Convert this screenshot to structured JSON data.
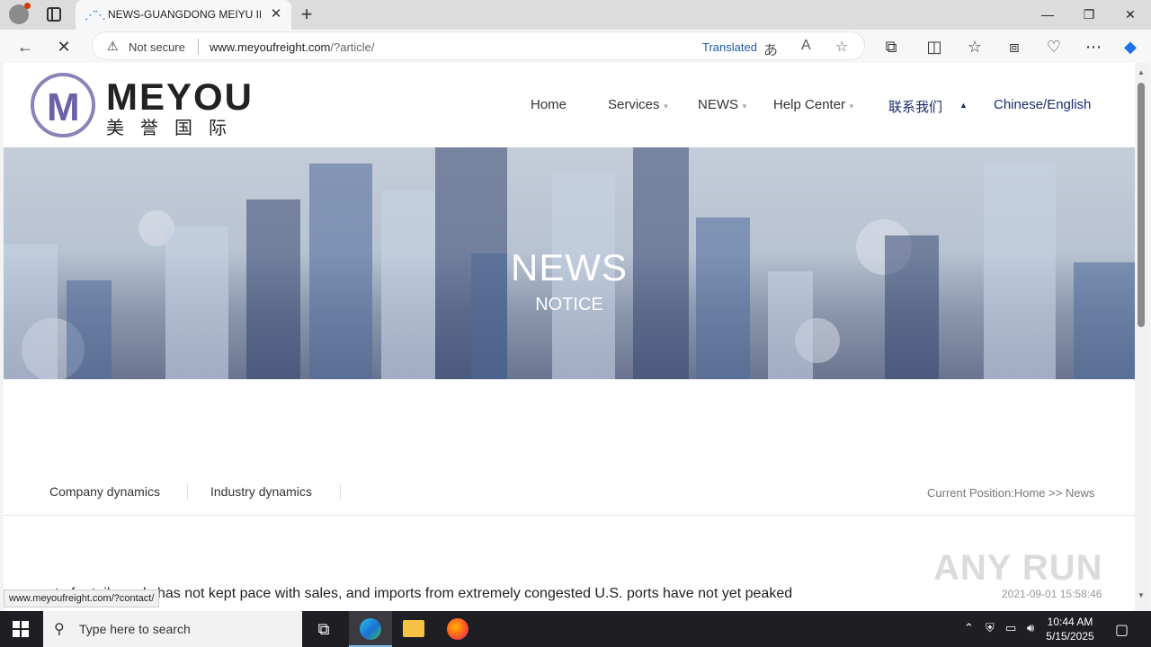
{
  "browser": {
    "tab_title": "NEWS-GUANGDONG MEIYU INTERNATIONAL",
    "tab_close": "✕",
    "new_tab": "+",
    "win_minimize": "—",
    "win_restore": "❐",
    "win_close": "✕",
    "not_secure": "Not secure",
    "url_host": "www.meyoufreight.com",
    "url_path": "/?article/",
    "translated": "Translated",
    "status_url": "www.meyoufreight.com/?contact/"
  },
  "site": {
    "logo_text": "MEYOU",
    "logo_cn": "美誉国际",
    "nav": {
      "home": "Home",
      "services": "Services",
      "news": "NEWS",
      "help": "Help Center",
      "contact_cn": "联系我们",
      "lang": "Chinese/English"
    },
    "banner_title": "NEWS",
    "banner_sub": "NOTICE",
    "subnav": {
      "company": "Company dynamics",
      "industry": "Industry dynamics",
      "crumb": "Current Position:Home >> News"
    },
    "article": {
      "title": "ment of retail goods has not kept pace with sales, and imports from extremely congested U.S. ports have not yet peaked",
      "date": "2021-09-01 15:58:46"
    },
    "watermark": "ANY RUN"
  },
  "taskbar": {
    "search_placeholder": "Type here to search",
    "time": "10:44 AM",
    "date": "5/15/2025"
  }
}
